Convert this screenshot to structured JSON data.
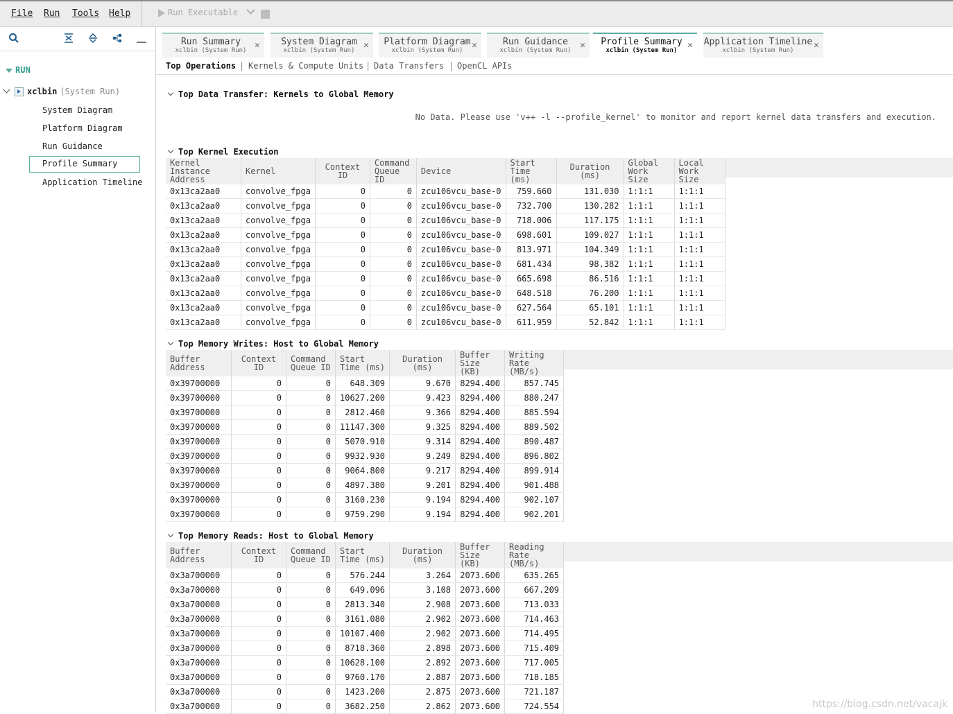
{
  "menu": {
    "items": [
      "File",
      "Run",
      "Tools",
      "Help"
    ],
    "run_executable": "Run Executable"
  },
  "sidebar": {
    "run_label": "RUN",
    "xclbin": "xclbin",
    "xclbin_sub": "(System Run)",
    "items": [
      "System Diagram",
      "Platform Diagram",
      "Run Guidance",
      "Profile Summary",
      "Application Timeline"
    ],
    "selected": "Profile Summary",
    "toolbar_icons": [
      "search-icon",
      "collapse-all-icon",
      "expand-all-icon",
      "hierarchy-icon",
      "minimize-icon"
    ]
  },
  "tabs": [
    {
      "label": "Run Summary",
      "sub": "xclbin (System Run)"
    },
    {
      "label": "System Diagram",
      "sub": "xclbin (System Run)"
    },
    {
      "label": "Platform Diagram",
      "sub": "xclbin (System Run)"
    },
    {
      "label": "Run Guidance",
      "sub": "xclbin (System Run)"
    },
    {
      "label": "Profile Summary",
      "sub": "xclbin (System Run)"
    },
    {
      "label": "Application Timeline",
      "sub": "xclbin (System Run)"
    }
  ],
  "active_tab": "Profile Summary",
  "subtabs": [
    "Top Operations",
    "Kernels & Compute Units",
    "Data Transfers",
    "OpenCL APIs"
  ],
  "sections": {
    "data_transfer": {
      "title": "Top Data Transfer: Kernels to Global Memory",
      "message": "No Data. Please use 'v++ -l --profile_kernel' to monitor and report kernel data transfers and execution."
    },
    "kernel_exec": {
      "title": "Top Kernel Execution",
      "columns": [
        [
          "Kernel Instance",
          "Address"
        ],
        [
          "Kernel",
          ""
        ],
        [
          "Context ID",
          ""
        ],
        [
          "Command",
          "Queue ID"
        ],
        [
          "Device",
          ""
        ],
        [
          "Start",
          "Time (ms)"
        ],
        [
          "Duration (ms)",
          ""
        ],
        [
          "Global",
          "Work Size"
        ],
        [
          "Local",
          "Work Size"
        ]
      ],
      "rows": [
        [
          "0x13ca2aa0",
          "convolve_fpga",
          "0",
          "0",
          "zcu106vcu_base-0",
          "759.660",
          "131.030",
          "1:1:1",
          "1:1:1"
        ],
        [
          "0x13ca2aa0",
          "convolve_fpga",
          "0",
          "0",
          "zcu106vcu_base-0",
          "732.700",
          "130.282",
          "1:1:1",
          "1:1:1"
        ],
        [
          "0x13ca2aa0",
          "convolve_fpga",
          "0",
          "0",
          "zcu106vcu_base-0",
          "718.006",
          "117.175",
          "1:1:1",
          "1:1:1"
        ],
        [
          "0x13ca2aa0",
          "convolve_fpga",
          "0",
          "0",
          "zcu106vcu_base-0",
          "698.601",
          "109.027",
          "1:1:1",
          "1:1:1"
        ],
        [
          "0x13ca2aa0",
          "convolve_fpga",
          "0",
          "0",
          "zcu106vcu_base-0",
          "813.971",
          "104.349",
          "1:1:1",
          "1:1:1"
        ],
        [
          "0x13ca2aa0",
          "convolve_fpga",
          "0",
          "0",
          "zcu106vcu_base-0",
          "681.434",
          "98.382",
          "1:1:1",
          "1:1:1"
        ],
        [
          "0x13ca2aa0",
          "convolve_fpga",
          "0",
          "0",
          "zcu106vcu_base-0",
          "665.698",
          "86.516",
          "1:1:1",
          "1:1:1"
        ],
        [
          "0x13ca2aa0",
          "convolve_fpga",
          "0",
          "0",
          "zcu106vcu_base-0",
          "648.518",
          "76.200",
          "1:1:1",
          "1:1:1"
        ],
        [
          "0x13ca2aa0",
          "convolve_fpga",
          "0",
          "0",
          "zcu106vcu_base-0",
          "627.564",
          "65.101",
          "1:1:1",
          "1:1:1"
        ],
        [
          "0x13ca2aa0",
          "convolve_fpga",
          "0",
          "0",
          "zcu106vcu_base-0",
          "611.959",
          "52.842",
          "1:1:1",
          "1:1:1"
        ]
      ]
    },
    "mem_writes": {
      "title": "Top Memory Writes: Host to Global Memory",
      "columns": [
        [
          "Buffer",
          "Address"
        ],
        [
          "Context ID",
          ""
        ],
        [
          "Command",
          "Queue ID"
        ],
        [
          "Start",
          "Time (ms)"
        ],
        [
          "Duration (ms)",
          ""
        ],
        [
          "Buffer",
          "Size (KB)"
        ],
        [
          "Writing",
          "Rate (MB/s)"
        ]
      ],
      "rows": [
        [
          "0x39700000",
          "0",
          "0",
          "648.309",
          "9.670",
          "8294.400",
          "857.745"
        ],
        [
          "0x39700000",
          "0",
          "0",
          "10627.200",
          "9.423",
          "8294.400",
          "880.247"
        ],
        [
          "0x39700000",
          "0",
          "0",
          "2812.460",
          "9.366",
          "8294.400",
          "885.594"
        ],
        [
          "0x39700000",
          "0",
          "0",
          "11147.300",
          "9.325",
          "8294.400",
          "889.502"
        ],
        [
          "0x39700000",
          "0",
          "0",
          "5070.910",
          "9.314",
          "8294.400",
          "890.487"
        ],
        [
          "0x39700000",
          "0",
          "0",
          "9932.930",
          "9.249",
          "8294.400",
          "896.802"
        ],
        [
          "0x39700000",
          "0",
          "0",
          "9064.800",
          "9.217",
          "8294.400",
          "899.914"
        ],
        [
          "0x39700000",
          "0",
          "0",
          "4897.380",
          "9.201",
          "8294.400",
          "901.488"
        ],
        [
          "0x39700000",
          "0",
          "0",
          "3160.230",
          "9.194",
          "8294.400",
          "902.107"
        ],
        [
          "0x39700000",
          "0",
          "0",
          "9759.290",
          "9.194",
          "8294.400",
          "902.201"
        ]
      ]
    },
    "mem_reads": {
      "title": "Top Memory Reads: Host to Global Memory",
      "columns": [
        [
          "Buffer",
          "Address"
        ],
        [
          "Context ID",
          ""
        ],
        [
          "Command",
          "Queue ID"
        ],
        [
          "Start",
          "Time (ms)"
        ],
        [
          "Duration (ms)",
          ""
        ],
        [
          "Buffer",
          "Size (KB)"
        ],
        [
          "Reading",
          "Rate (MB/s)"
        ]
      ],
      "rows": [
        [
          "0x3a700000",
          "0",
          "0",
          "576.244",
          "3.264",
          "2073.600",
          "635.265"
        ],
        [
          "0x3a700000",
          "0",
          "0",
          "649.096",
          "3.108",
          "2073.600",
          "667.209"
        ],
        [
          "0x3a700000",
          "0",
          "0",
          "2813.340",
          "2.908",
          "2073.600",
          "713.033"
        ],
        [
          "0x3a700000",
          "0",
          "0",
          "3161.080",
          "2.902",
          "2073.600",
          "714.463"
        ],
        [
          "0x3a700000",
          "0",
          "0",
          "10107.400",
          "2.902",
          "2073.600",
          "714.495"
        ],
        [
          "0x3a700000",
          "0",
          "0",
          "8718.360",
          "2.898",
          "2073.600",
          "715.409"
        ],
        [
          "0x3a700000",
          "0",
          "0",
          "10628.100",
          "2.892",
          "2073.600",
          "717.005"
        ],
        [
          "0x3a700000",
          "0",
          "0",
          "9760.170",
          "2.887",
          "2073.600",
          "718.185"
        ],
        [
          "0x3a700000",
          "0",
          "0",
          "1423.200",
          "2.875",
          "2073.600",
          "721.187"
        ],
        [
          "0x3a700000",
          "0",
          "0",
          "3682.250",
          "2.862",
          "2073.600",
          "724.554"
        ]
      ]
    }
  },
  "watermark": "https://blog.csdn.net/vacajk",
  "colors": {
    "accent": "#5fae9f",
    "run_label": "#2e9c8a",
    "header_bg": "#efefef"
  }
}
